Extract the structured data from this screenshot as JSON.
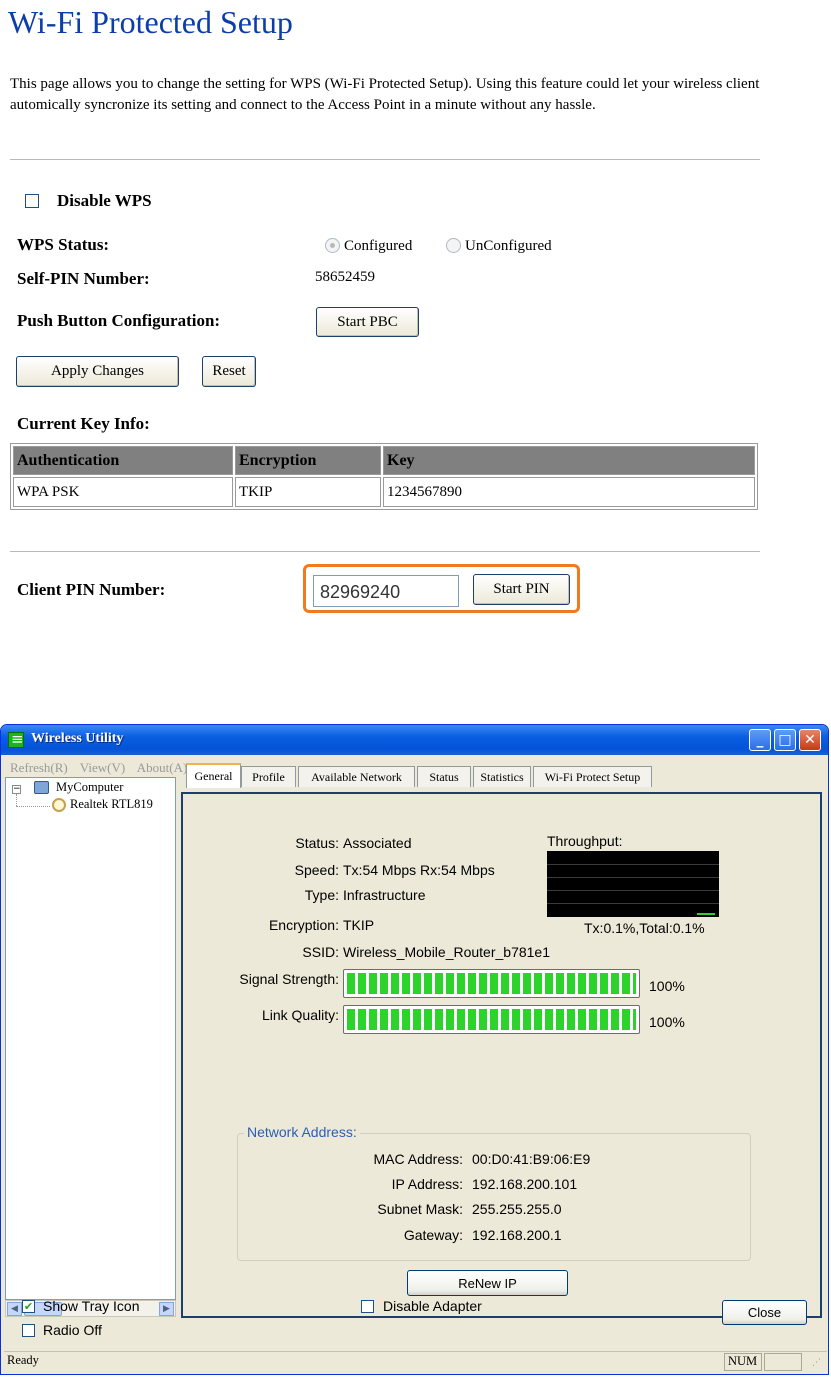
{
  "wps": {
    "title": "Wi-Fi Protected Setup",
    "description": "This page allows you to change the setting for WPS (Wi-Fi Protected Setup). Using this feature could let your wireless client automically syncronize its setting and connect to the Access Point in a minute without any hassle.",
    "disable_label": "Disable WPS",
    "disable_checked": false,
    "status_label": "WPS Status:",
    "status_options": [
      "Configured",
      "UnConfigured"
    ],
    "status_selected": "Configured",
    "self_pin_label": "Self-PIN Number:",
    "self_pin_value": "58652459",
    "pbc_label": "Push Button Configuration:",
    "pbc_button": "Start PBC",
    "apply_button": "Apply Changes",
    "reset_button": "Reset",
    "key_info_label": "Current Key Info:",
    "key_table": {
      "headers": [
        "Authentication",
        "Encryption",
        "Key"
      ],
      "rows": [
        [
          "WPA PSK",
          "TKIP",
          "1234567890"
        ]
      ]
    },
    "client_pin_label": "Client PIN Number:",
    "client_pin_value": "82969240",
    "start_pin_button": "Start PIN",
    "highlight_color": "#f07a1f"
  },
  "utility": {
    "window_title": "Wireless Utility",
    "menu": [
      "Refresh(R)",
      "View(V)",
      "About(A)"
    ],
    "tree": {
      "root": "MyComputer",
      "child": "Realtek RTL819"
    },
    "tabs": [
      "General",
      "Profile",
      "Available Network",
      "Status",
      "Statistics",
      "Wi-Fi Protect Setup"
    ],
    "active_tab": "General",
    "general": {
      "status_label": "Status:",
      "status_value": "Associated",
      "speed_label": "Speed:",
      "speed_value": "Tx:54 Mbps Rx:54 Mbps",
      "type_label": "Type:",
      "type_value": "Infrastructure",
      "encryption_label": "Encryption:",
      "encryption_value": "TKIP",
      "ssid_label": "SSID:",
      "ssid_value": "Wireless_Mobile_Router_b781e1",
      "throughput_label": "Throughput:",
      "throughput_value": "Tx:0.1%,Total:0.1%",
      "signal_label": "Signal Strength:",
      "signal_value": "100%",
      "signal_level": 1.0,
      "link_label": "Link Quality:",
      "link_value": "100%",
      "link_level": 1.0,
      "meter_color": "#2bd32b"
    },
    "network": {
      "group_label": "Network Address:",
      "mac_label": "MAC Address:",
      "mac_value": "00:D0:41:B9:06:E9",
      "ip_label": "IP Address:",
      "ip_value": "192.168.200.101",
      "mask_label": "Subnet Mask:",
      "mask_value": "255.255.255.0",
      "gateway_label": "Gateway:",
      "gateway_value": "192.168.200.1",
      "renew_button": "ReNew IP"
    },
    "bottom": {
      "show_tray_label": "Show Tray Icon",
      "show_tray_checked": true,
      "radio_off_label": "Radio Off",
      "radio_off_checked": false,
      "disable_adapter_label": "Disable Adapter",
      "disable_adapter_checked": false,
      "close_button": "Close"
    },
    "statusbar": {
      "status": "Ready",
      "num": "NUM"
    }
  }
}
